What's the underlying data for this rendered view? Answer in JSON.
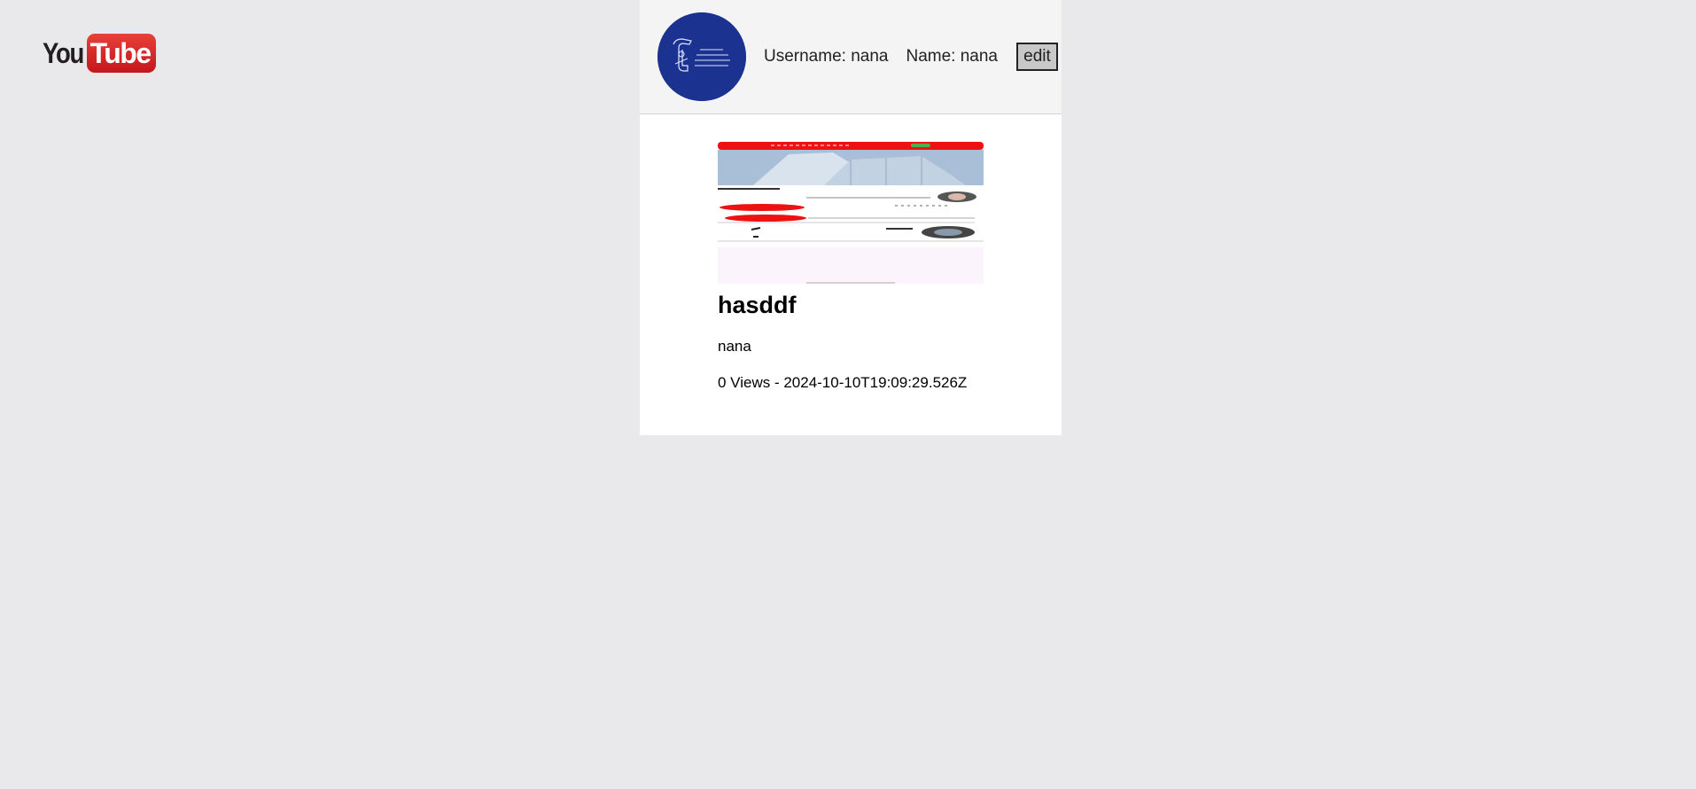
{
  "logo": {
    "you": "You",
    "tube": "Tube"
  },
  "profile": {
    "username_label": "Username: nana",
    "name_label": "Name: nana",
    "edit_label": "edit"
  },
  "videos": [
    {
      "title": "hasddf",
      "owner": "nana",
      "meta": "0 Views - 2024-10-10T19:09:29.526Z"
    }
  ],
  "colors": {
    "page_background": "#e9e8eb",
    "avatar_blue": "#1b3290",
    "youtube_red": "#d32323"
  }
}
